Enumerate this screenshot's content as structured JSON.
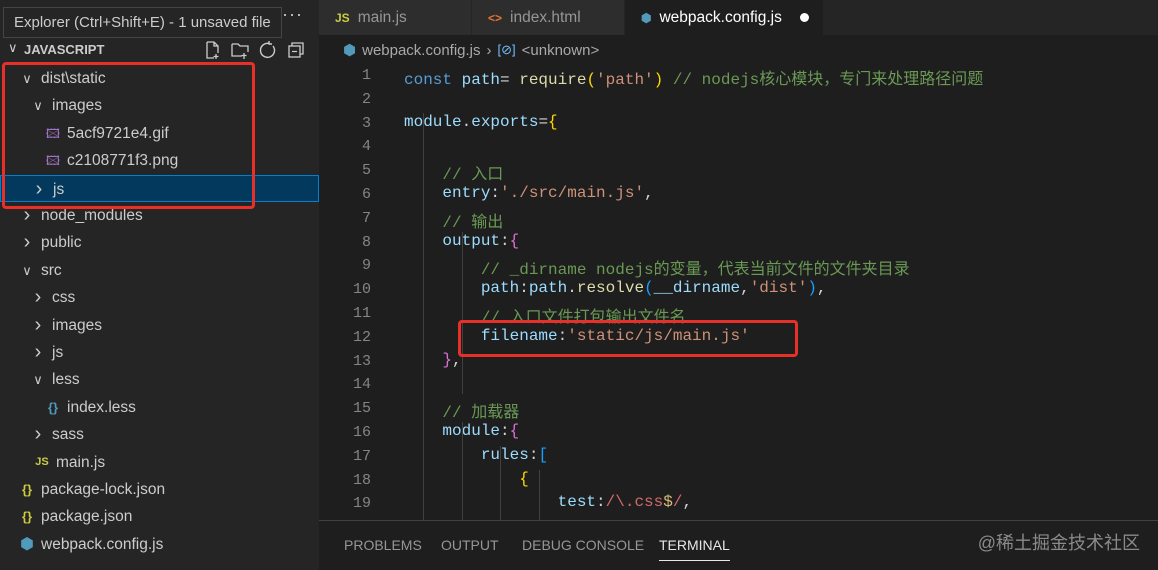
{
  "tooltip": "Explorer (Ctrl+Shift+E) - 1 unsaved file",
  "more_label": "···",
  "section_title": "JAVASCRIPT",
  "section_actions": [
    "new-file-icon",
    "new-folder-icon",
    "refresh-icon",
    "collapse-all-icon"
  ],
  "tree": [
    {
      "label": "dist\\static",
      "type": "folder",
      "open": true,
      "depth": 0
    },
    {
      "label": "images",
      "type": "folder",
      "open": true,
      "depth": 1
    },
    {
      "label": "5acf9721e4.gif",
      "type": "image",
      "depth": 2
    },
    {
      "label": "c2108771f3.png",
      "type": "image",
      "depth": 2
    },
    {
      "label": "js",
      "type": "folder",
      "open": false,
      "depth": 1,
      "selected": true
    },
    {
      "label": "node_modules",
      "type": "folder",
      "open": false,
      "depth": 0
    },
    {
      "label": "public",
      "type": "folder",
      "open": false,
      "depth": 0
    },
    {
      "label": "src",
      "type": "folder",
      "open": true,
      "depth": 0
    },
    {
      "label": "css",
      "type": "folder",
      "open": false,
      "depth": 1
    },
    {
      "label": "images",
      "type": "folder",
      "open": false,
      "depth": 1
    },
    {
      "label": "js",
      "type": "folder",
      "open": false,
      "depth": 1
    },
    {
      "label": "less",
      "type": "folder",
      "open": true,
      "depth": 1
    },
    {
      "label": "index.less",
      "type": "less",
      "depth": 2
    },
    {
      "label": "sass",
      "type": "folder",
      "open": false,
      "depth": 1
    },
    {
      "label": "main.js",
      "type": "js",
      "depth": 1
    },
    {
      "label": "package-lock.json",
      "type": "json",
      "depth": 0
    },
    {
      "label": "package.json",
      "type": "json",
      "depth": 0
    },
    {
      "label": "webpack.config.js",
      "type": "webpack",
      "depth": 0
    }
  ],
  "tabs": [
    {
      "label": "main.js",
      "icon": "js",
      "active": false
    },
    {
      "label": "index.html",
      "icon": "html",
      "active": false
    },
    {
      "label": "webpack.config.js",
      "icon": "webpack",
      "active": true,
      "unsaved": true
    }
  ],
  "breadcrumb": {
    "file": "webpack.config.js",
    "symbol": "<unknown>"
  },
  "code": [
    [
      [
        "k",
        "const "
      ],
      [
        "v",
        "path"
      ],
      [
        "p",
        "= "
      ],
      [
        "f",
        "require"
      ],
      [
        "b1",
        "("
      ],
      [
        "s",
        "'path'"
      ],
      [
        "b1",
        ")"
      ],
      [
        "c",
        " // nodejs核心模块，专门来处理路径问题"
      ]
    ],
    [],
    [
      [
        "v",
        "module"
      ],
      [
        "p",
        "."
      ],
      [
        "v",
        "exports"
      ],
      [
        "p",
        "="
      ],
      [
        "b1",
        "{"
      ]
    ],
    [],
    [
      [
        "p",
        "    "
      ],
      [
        "c",
        "// 入口"
      ]
    ],
    [
      [
        "p",
        "    "
      ],
      [
        "v",
        "entry"
      ],
      [
        "p",
        ":"
      ],
      [
        "s",
        "'./src/main.js'"
      ],
      [
        "p",
        ","
      ]
    ],
    [
      [
        "p",
        "    "
      ],
      [
        "c",
        "// 输出"
      ]
    ],
    [
      [
        "p",
        "    "
      ],
      [
        "v",
        "output"
      ],
      [
        "p",
        ":"
      ],
      [
        "b2",
        "{"
      ]
    ],
    [
      [
        "p",
        "        "
      ],
      [
        "c",
        "// _dirname nodejs的变量，代表当前文件的文件夹目录"
      ]
    ],
    [
      [
        "p",
        "        "
      ],
      [
        "v",
        "path"
      ],
      [
        "p",
        ":"
      ],
      [
        "v",
        "path"
      ],
      [
        "p",
        "."
      ],
      [
        "f",
        "resolve"
      ],
      [
        "b3",
        "("
      ],
      [
        "v",
        "__dirname"
      ],
      [
        "p",
        ","
      ],
      [
        "s",
        "'dist'"
      ],
      [
        "b3",
        ")"
      ],
      [
        "p",
        ","
      ]
    ],
    [
      [
        "p",
        "        "
      ],
      [
        "c",
        "// 入口文件打包输出文件名"
      ]
    ],
    [
      [
        "p",
        "        "
      ],
      [
        "v",
        "filename"
      ],
      [
        "p",
        ":"
      ],
      [
        "s",
        "'static/js/main.js'"
      ]
    ],
    [
      [
        "p",
        "    "
      ],
      [
        "b2",
        "}"
      ],
      [
        "p",
        ","
      ]
    ],
    [],
    [
      [
        "p",
        "    "
      ],
      [
        "c",
        "// 加载器"
      ]
    ],
    [
      [
        "p",
        "    "
      ],
      [
        "v",
        "module"
      ],
      [
        "p",
        ":"
      ],
      [
        "b2",
        "{"
      ]
    ],
    [
      [
        "p",
        "        "
      ],
      [
        "v",
        "rules"
      ],
      [
        "p",
        ":"
      ],
      [
        "b3",
        "["
      ]
    ],
    [
      [
        "p",
        "            "
      ],
      [
        "b1",
        "{"
      ]
    ],
    [
      [
        "p",
        "                "
      ],
      [
        "v",
        "test"
      ],
      [
        "p",
        ":"
      ],
      [
        "r",
        "/\\."
      ],
      [
        "r",
        "css"
      ],
      [
        "re",
        "$"
      ],
      [
        "r",
        "/"
      ],
      [
        "p",
        ","
      ]
    ]
  ],
  "panel_tabs": [
    {
      "label": "PROBLEMS",
      "active": false
    },
    {
      "label": "OUTPUT",
      "active": false
    },
    {
      "label": "DEBUG CONSOLE",
      "active": false
    },
    {
      "label": "TERMINAL",
      "active": true
    }
  ],
  "watermark": "@稀土掘金技术社区",
  "colors": {
    "highlight": "#e8302a",
    "selection": "#04395e",
    "focus_border": "#007fd4"
  }
}
